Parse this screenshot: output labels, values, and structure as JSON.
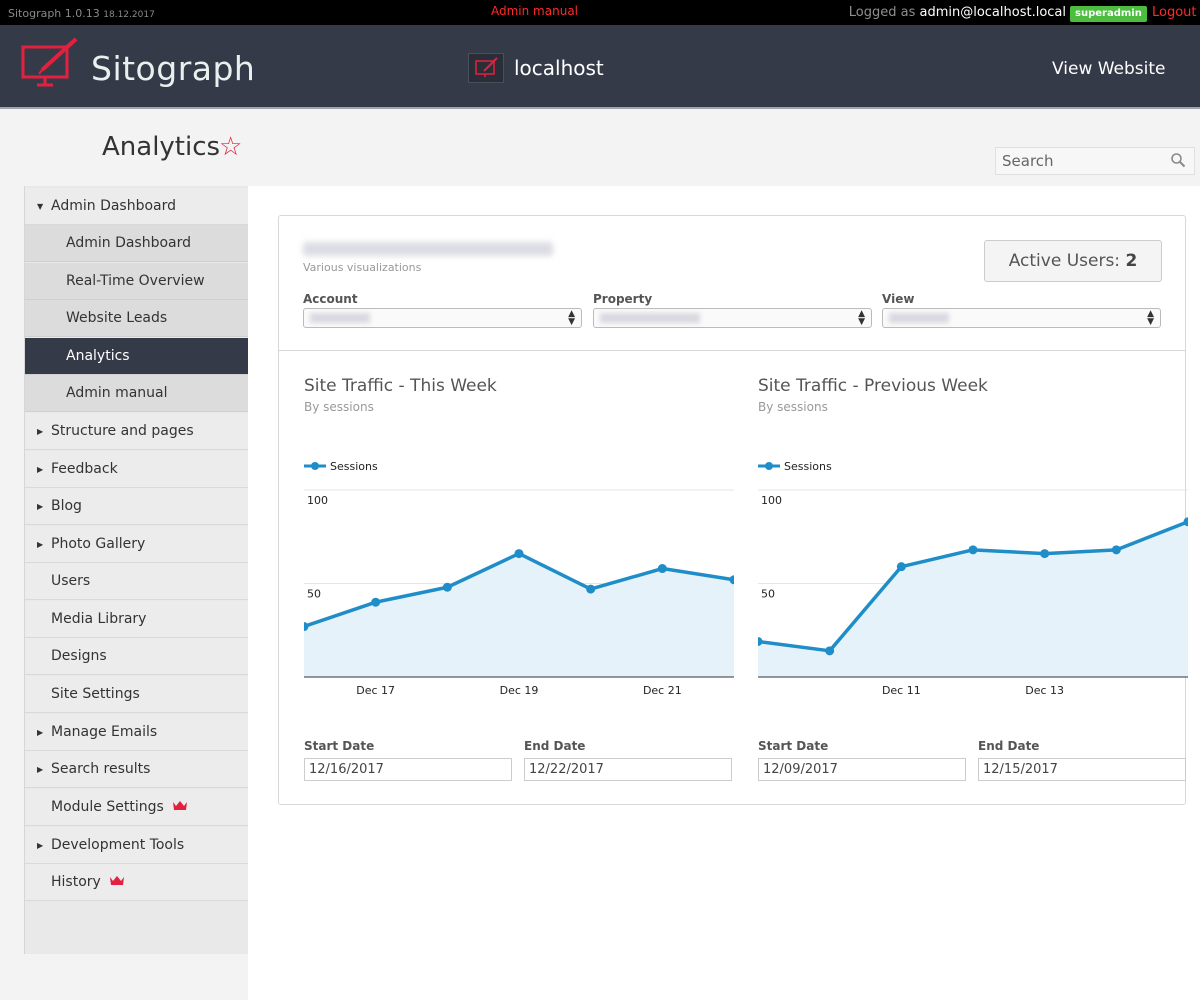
{
  "topbar": {
    "version": "Sitograph 1.0.13",
    "version_date": "18.12.2017",
    "admin_manual": "Admin manual",
    "logged_as": "Logged as",
    "user": "admin@localhost.local",
    "role": "superadmin",
    "logout": "Logout"
  },
  "header": {
    "logo_text": "Sitograph",
    "site_name": "localhost",
    "view_website": "View Website"
  },
  "page": {
    "title": "Analytics",
    "star_icon": "star-outline-icon",
    "search_placeholder": "Search"
  },
  "sidebar": {
    "items": [
      {
        "label": "Admin Dashboard",
        "caret": "▼"
      },
      {
        "label": "Admin Dashboard"
      },
      {
        "label": "Real-Time Overview"
      },
      {
        "label": "Website Leads"
      },
      {
        "label": "Analytics"
      },
      {
        "label": "Admin manual"
      },
      {
        "label": "Structure and pages",
        "caret": "▶"
      },
      {
        "label": "Feedback",
        "caret": "▶"
      },
      {
        "label": "Blog",
        "caret": "▶"
      },
      {
        "label": "Photo Gallery",
        "caret": "▶"
      },
      {
        "label": "Users"
      },
      {
        "label": "Media Library"
      },
      {
        "label": "Designs"
      },
      {
        "label": "Site Settings"
      },
      {
        "label": "Manage Emails",
        "caret": "▶"
      },
      {
        "label": "Search results",
        "caret": "▶"
      },
      {
        "label": "Module Settings"
      },
      {
        "label": "Development Tools",
        "caret": "▶"
      },
      {
        "label": "History"
      }
    ]
  },
  "panel": {
    "subtitle": "Various visualizations",
    "active_users_label": "Active Users:",
    "active_users_value": "2",
    "account_label": "Account",
    "property_label": "Property",
    "view_label": "View",
    "start_date_label": "Start Date",
    "end_date_label": "End Date"
  },
  "colors": {
    "line": "#1f8dc8",
    "area": "#e6f2fa",
    "accent_red": "#e3203e",
    "header_bg": "#353a48"
  },
  "chart_data": [
    {
      "type": "area",
      "title": "Site Traffic - This Week",
      "subtitle": "By sessions",
      "series": [
        {
          "name": "Sessions",
          "values": [
            27,
            40,
            48,
            66,
            47,
            58,
            52
          ]
        }
      ],
      "x": [
        "Dec 16",
        "Dec 17",
        "Dec 18",
        "Dec 19",
        "Dec 20",
        "Dec 21",
        "Dec 22"
      ],
      "tick_labels": [
        "",
        "Dec 17",
        "",
        "Dec 19",
        "",
        "Dec 21",
        ""
      ],
      "ylim": [
        0,
        100
      ],
      "yticks": [
        100,
        50
      ],
      "grid": true,
      "legend": "top-left",
      "start_date": "12/16/2017",
      "end_date": "12/22/2017"
    },
    {
      "type": "area",
      "title": "Site Traffic - Previous Week",
      "subtitle": "By sessions",
      "series": [
        {
          "name": "Sessions",
          "values": [
            19,
            14,
            59,
            68,
            66,
            68,
            83
          ]
        }
      ],
      "x": [
        "Dec 9",
        "Dec 10",
        "Dec 11",
        "Dec 12",
        "Dec 13",
        "Dec 14",
        "Dec 15"
      ],
      "tick_labels": [
        "",
        "",
        "Dec 11",
        "",
        "Dec 13",
        "",
        ""
      ],
      "ylim": [
        0,
        100
      ],
      "yticks": [
        100,
        50
      ],
      "grid": true,
      "legend": "top-left",
      "start_date": "12/09/2017",
      "end_date": "12/15/2017"
    }
  ]
}
